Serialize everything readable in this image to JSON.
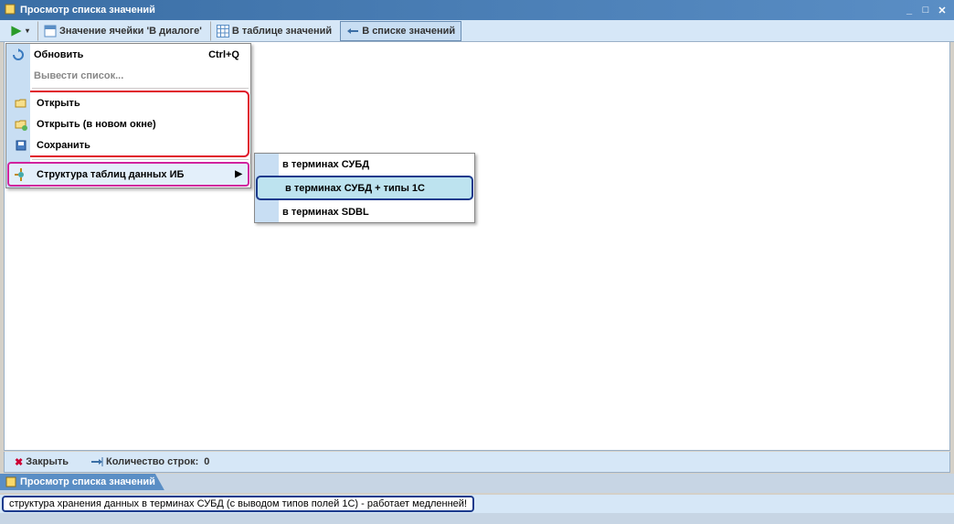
{
  "window": {
    "title": "Просмотр списка значений"
  },
  "toolbar": {
    "cell_value": "Значение ячейки 'В диалоге'",
    "in_value_table": "В таблице значений",
    "in_value_list": "В списке значений"
  },
  "menu": {
    "update": "Обновить",
    "update_shortcut": "Ctrl+Q",
    "export_list": "Вывести список...",
    "open": "Открыть",
    "open_new": "Открыть (в новом окне)",
    "save": "Сохранить",
    "structure": "Структура таблиц данных ИБ"
  },
  "submenu": {
    "terms_subd": "в терминах СУБД",
    "terms_subd_1c": "в терминах СУБД + типы 1С",
    "terms_sdbl": "в терминах SDBL"
  },
  "bottom": {
    "close": "Закрыть",
    "row_count_label": "Количество строк:",
    "row_count_value": "0"
  },
  "tab": {
    "label": "Просмотр списка значений"
  },
  "status": {
    "text": "структура хранения данных в терминах СУБД (с выводом типов полей 1С) - работает медленней!"
  }
}
